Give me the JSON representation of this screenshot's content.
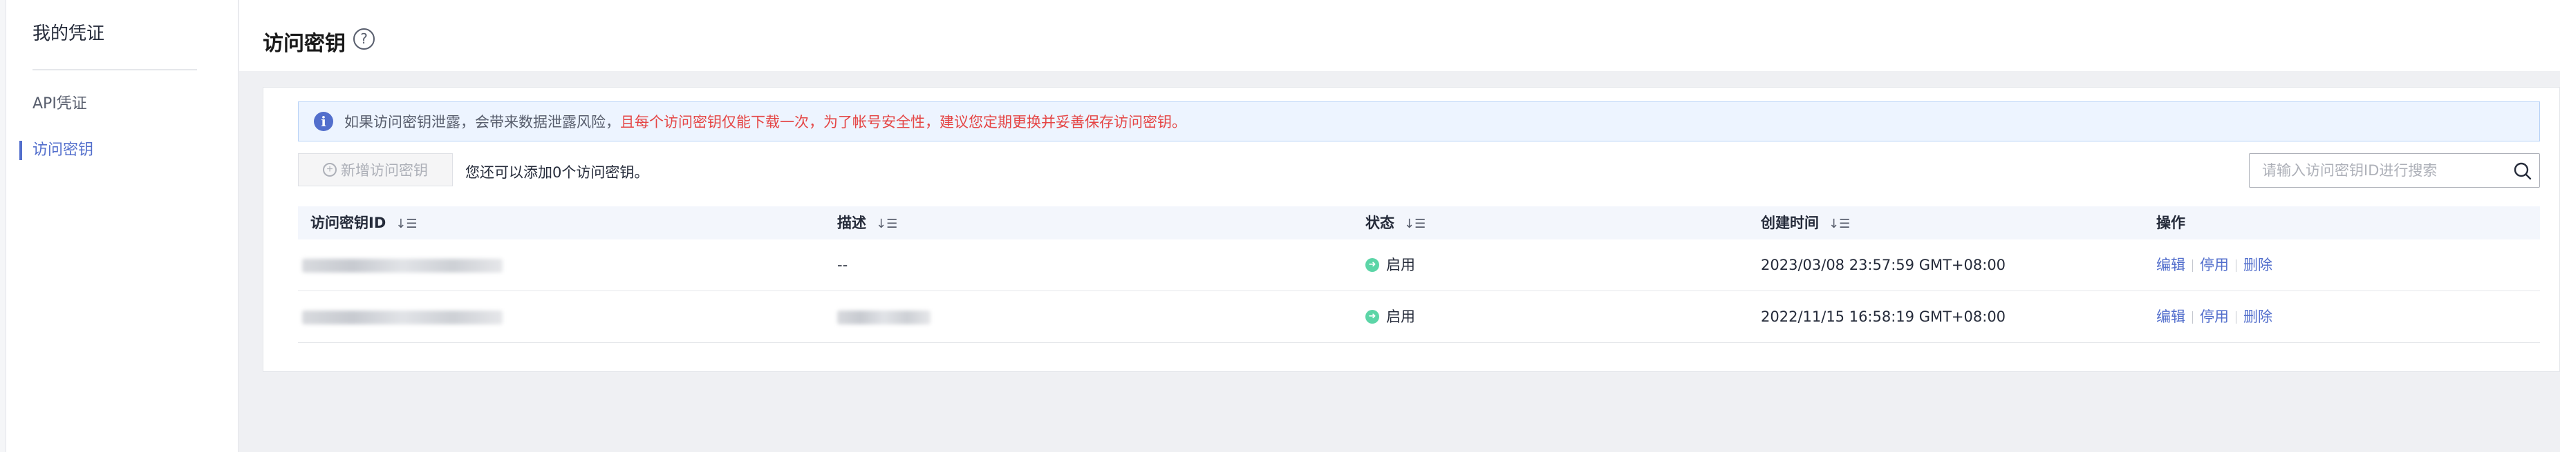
{
  "sidebar": {
    "title": "我的凭证",
    "items": [
      {
        "label": "API凭证"
      },
      {
        "label": "访问密钥"
      }
    ]
  },
  "header": {
    "title": "访问密钥",
    "help_icon": "question-circle-icon"
  },
  "alert": {
    "text": "如果访问密钥泄露，会带来数据泄露风险，",
    "warning": "且每个访问密钥仅能下载一次，为了帐号安全性，建议您定期更换并妥善保存访问密钥。",
    "icon": "info-icon",
    "warning_color": "#e54545"
  },
  "toolbar": {
    "new_button_label": "新增访问密钥",
    "quota_text": "您还可以添加0个访问密钥。",
    "search_placeholder": "请输入访问密钥ID进行搜索"
  },
  "table": {
    "columns": [
      "访问密钥ID",
      "描述",
      "状态",
      "创建时间",
      "操作"
    ],
    "rows": [
      {
        "description": "--",
        "status": "启用",
        "created": "2023/03/08 23:57:59 GMT+08:00"
      },
      {
        "description": "",
        "status": "启用",
        "created": "2022/11/15 16:58:19 GMT+08:00"
      }
    ],
    "actions": [
      "编辑",
      "停用",
      "删除"
    ]
  },
  "colors": {
    "accent": "#526ecc",
    "status_enabled": "#5cd5a7"
  }
}
